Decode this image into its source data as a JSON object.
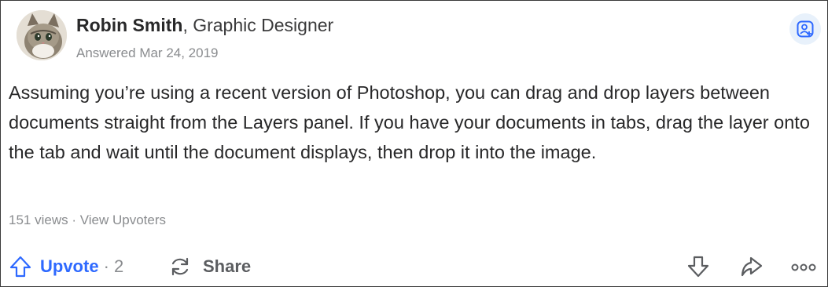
{
  "answer_card": {
    "author_name": "Robin Smith",
    "author_separator": ", ",
    "author_credential": "Graphic Designer",
    "answered_date": "Answered Mar 24, 2019",
    "body": "Assuming you’re using a recent version of Photoshop, you can drag and drop layers between documents straight from the Layers panel. If you have your documents in tabs, drag the layer onto the tab and wait until the document displays, then drop it into the image.",
    "views": "151 views",
    "stats_separator": " · ",
    "view_upvoters_label": "View Upvoters"
  },
  "actions": {
    "upvote_label": "Upvote",
    "upvote_count": "· 2",
    "share_label": "Share"
  },
  "icons": {
    "avatar": "cat-avatar",
    "follow": "add-user-icon",
    "upvote": "arrow-up-icon",
    "share": "share-cycle-icon",
    "downvote": "arrow-down-icon",
    "forward": "forward-arrow-icon",
    "more": "ellipsis-icon"
  },
  "colors": {
    "accent_blue": "#2e69ff",
    "icon_gray": "#5b5d60",
    "meta_gray": "#8a8c8f",
    "text": "#282829",
    "follow_bg": "#e8f1fb"
  }
}
